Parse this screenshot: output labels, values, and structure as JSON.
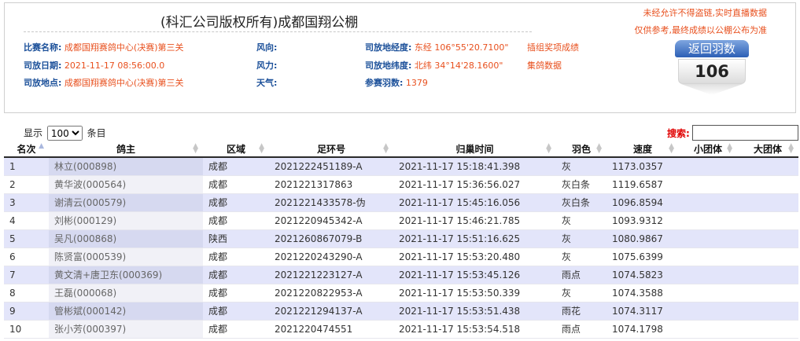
{
  "header": {
    "title": "(科汇公司版权所有)成都国翔公棚",
    "notice_line1": "未经允许不得盗链,实时直播数据",
    "notice_line2": "仅供参考,最终成绩以公棚公布为准"
  },
  "info": {
    "race_name_label": "比赛名称:",
    "race_name": "成都国翔赛鸽中心(决赛)第三关",
    "release_date_label": "司放日期:",
    "release_date": "2021-11-17 08:56:00.0",
    "release_place_label": "司放地点:",
    "release_place": "成都国翔赛鸽中心(决赛)第三关",
    "wind_dir_label": "风向:",
    "wind_force_label": "风力:",
    "weather_label": "天气:",
    "longitude_label": "司放地经度:",
    "longitude": "东经 106°55'20.7100\"",
    "latitude_label": "司放地纬度:",
    "latitude": "北纬 34°14'28.1600\"",
    "count_label": "参赛羽数:",
    "count": "1379",
    "link_group_results": "插组奖项成绩",
    "link_pigeon_data": "集鸽数据"
  },
  "badge": {
    "label": "返回羽数",
    "value": "106"
  },
  "controls": {
    "show_prefix": "显示",
    "page_size": "100",
    "show_suffix": "条目",
    "search_label": "搜索:",
    "search_value": ""
  },
  "table": {
    "columns": [
      "名次",
      "鸽主",
      "区域",
      "足环号",
      "归巢时间",
      "羽色",
      "速度",
      "小团体",
      "大团体"
    ],
    "rows": [
      [
        "1",
        "林立(000898)",
        "成都",
        "2021222451189-A",
        "2021-11-17 15:18:41.398",
        "灰",
        "1173.0357",
        "",
        ""
      ],
      [
        "2",
        "黄华波(000564)",
        "成都",
        "2021221317863",
        "2021-11-17 15:36:56.027",
        "灰白条",
        "1119.6587",
        "",
        ""
      ],
      [
        "3",
        "谢清云(000579)",
        "成都",
        "2021221433578-伪",
        "2021-11-17 15:45:16.056",
        "灰白条",
        "1096.8594",
        "",
        ""
      ],
      [
        "4",
        "刘彬(000129)",
        "成都",
        "2021220945342-A",
        "2021-11-17 15:46:21.785",
        "灰",
        "1093.9312",
        "",
        ""
      ],
      [
        "5",
        "吴凡(000868)",
        "陕西",
        "2021260867079-B",
        "2021-11-17 15:51:16.625",
        "灰",
        "1080.9867",
        "",
        ""
      ],
      [
        "6",
        "陈贤富(000539)",
        "成都",
        "2021220243290-A",
        "2021-11-17 15:53:20.480",
        "灰",
        "1075.6399",
        "",
        ""
      ],
      [
        "7",
        "黄文清+唐卫东(000369)",
        "成都",
        "2021221223127-A",
        "2021-11-17 15:53:45.126",
        "雨点",
        "1074.5823",
        "",
        ""
      ],
      [
        "8",
        "王磊(000068)",
        "成都",
        "2021220822953-A",
        "2021-11-17 15:53:50.339",
        "灰",
        "1074.3588",
        "",
        ""
      ],
      [
        "9",
        "管彬斌(000142)",
        "成都",
        "2021221294137-A",
        "2021-11-17 15:53:51.438",
        "雨花",
        "1074.3117",
        "",
        ""
      ],
      [
        "10",
        "张小芳(000397)",
        "成都",
        "2021220474551",
        "2021-11-17 15:53:54.518",
        "雨点",
        "1074.1798",
        "",
        ""
      ]
    ]
  }
}
